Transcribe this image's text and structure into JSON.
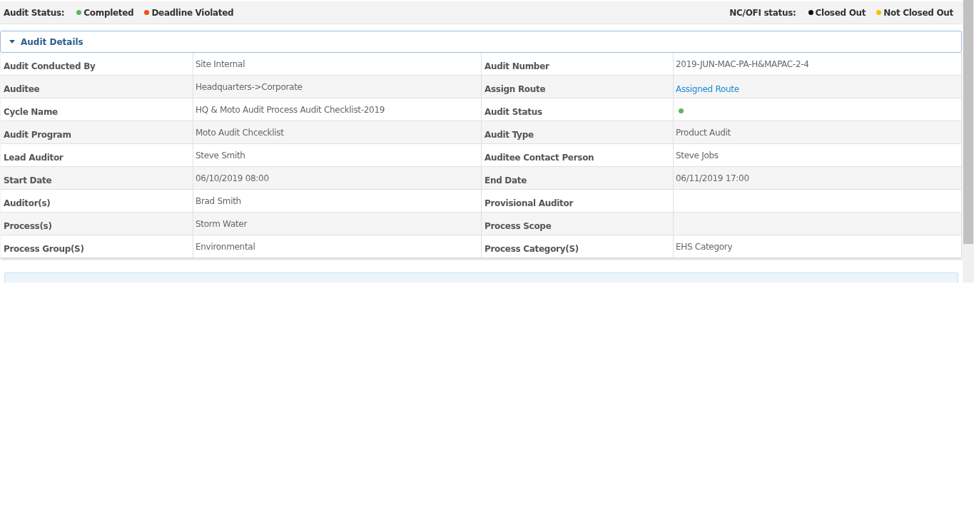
{
  "legend_bar": {
    "audit_status": {
      "label": "Audit Status:",
      "items": [
        {
          "label": "Completed",
          "color": "#5cb85c"
        },
        {
          "label": "Deadline Violated",
          "color": "#f04e0e"
        }
      ]
    },
    "nc_status": {
      "label": "NC/OFI status:",
      "items": [
        {
          "label": "Closed Out",
          "color": "#111111"
        },
        {
          "label": "Not Closed Out",
          "color": "#f5c400"
        }
      ]
    }
  },
  "audit_details": {
    "title": "Audit Details",
    "expanded": true,
    "rows": [
      {
        "left": {
          "label": "Audit Conducted By",
          "value": "Site Internal"
        },
        "right": {
          "label": "Audit Number",
          "value": "2019-JUN-MAC-PA-H&MAPAC-2-4"
        }
      },
      {
        "left": {
          "label": "Auditee",
          "value": "Headquarters->Corporate"
        },
        "right": {
          "label": "Assign Route",
          "kind": "link",
          "value": "Assigned Route"
        }
      },
      {
        "left": {
          "label": "Cycle Name",
          "value": "HQ & Moto Audit Process Audit Checklist-2019"
        },
        "right": {
          "label": "Audit Status",
          "kind": "dot",
          "color": "#5cb85c"
        }
      },
      {
        "left": {
          "label": "Audit Program",
          "value": "Moto Audit Chcecklist"
        },
        "right": {
          "label": "Audit Type",
          "value": "Product Audit"
        }
      },
      {
        "left": {
          "label": "Lead Auditor",
          "value": "Steve Smith"
        },
        "right": {
          "label": "Auditee Contact Person",
          "value": "Steve Jobs"
        }
      },
      {
        "left": {
          "label": "Start Date",
          "value": "06/10/2019 08:00"
        },
        "right": {
          "label": "End Date",
          "value": "06/11/2019 17:00"
        }
      },
      {
        "left": {
          "label": "Auditor(s)",
          "value": "Brad Smith"
        },
        "right": {
          "label": "Provisional Auditor"
        }
      },
      {
        "left": {
          "label": "Process(s)",
          "value": "Storm Water"
        },
        "right": {
          "label": "Process Scope"
        }
      },
      {
        "left": {
          "label": "Process Group(S)",
          "value": "Environmental"
        },
        "right": {
          "label": "Process Category(S)",
          "value": "EHS Category"
        }
      }
    ]
  }
}
